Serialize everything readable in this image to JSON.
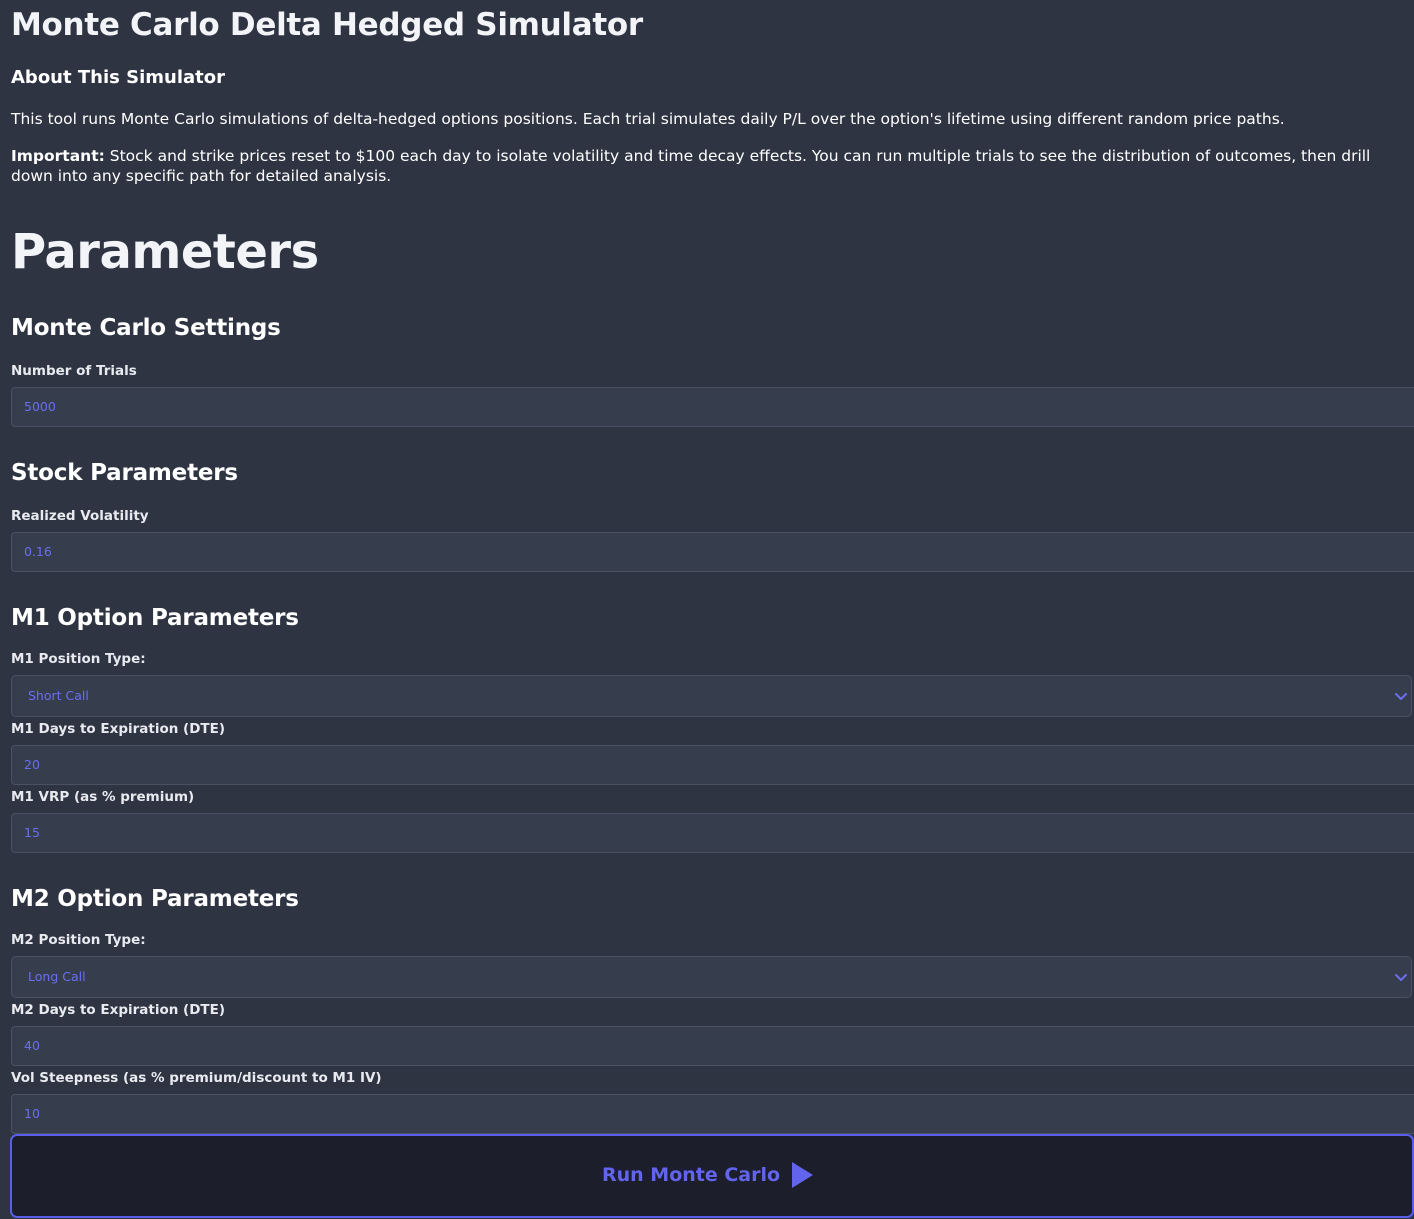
{
  "app": {
    "title": "Monte Carlo Delta Hedged Simulator"
  },
  "about": {
    "heading": "About This Simulator",
    "paragraph1": "This tool runs Monte Carlo simulations of delta-hedged options positions. Each trial simulates daily P/L over the option's lifetime using different random price paths.",
    "important_label": "Important:",
    "paragraph2": " Stock and strike prices reset to $100 each day to isolate volatility and time decay effects. You can run multiple trials to see the distribution of outcomes, then drill down into any specific path for detailed analysis."
  },
  "parameters": {
    "heading": "Parameters",
    "monte_carlo": {
      "heading": "Monte Carlo Settings",
      "trials_label": "Number of Trials",
      "trials_value": "5000"
    },
    "stock": {
      "heading": "Stock Parameters",
      "vol_label": "Realized Volatility",
      "vol_value": "0.16"
    },
    "m1": {
      "heading": "M1 Option Parameters",
      "position_label": "M1 Position Type:",
      "position_value": "Short Call",
      "dte_label": "M1 Days to Expiration (DTE)",
      "dte_value": "20",
      "vrp_label": "M1 VRP (as % premium)",
      "vrp_value": "15"
    },
    "m2": {
      "heading": "M2 Option Parameters",
      "position_label": "M2 Position Type:",
      "position_value": "Long Call",
      "dte_label": "M2 Days to Expiration (DTE)",
      "dte_value": "40",
      "steepness_label": "Vol Steepness (as % premium/discount to M1 IV)",
      "steepness_value": "10"
    }
  },
  "run_button": {
    "label": "Run Monte Carlo",
    "icon": "play-icon"
  },
  "colors": {
    "background": "#2e3442",
    "input_background": "#363d4c",
    "accent": "#6264ee",
    "button_background": "#1c1f2b"
  }
}
